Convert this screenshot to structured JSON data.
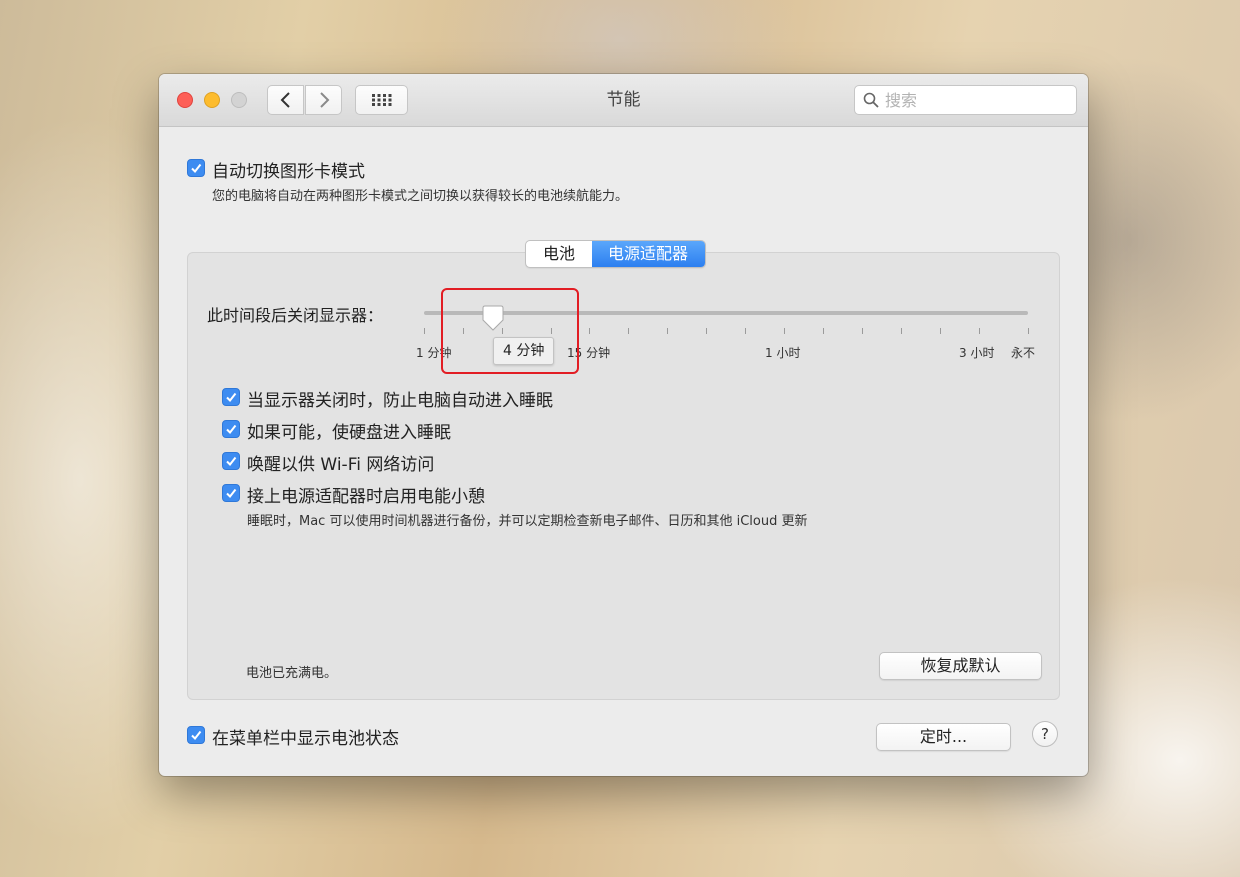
{
  "window": {
    "title": "节能",
    "search_placeholder": "搜索",
    "accent_color": "#3d8cf1"
  },
  "graphics_switching": {
    "checked": true,
    "label": "自动切换图形卡模式",
    "description": "您的电脑将自动在两种图形卡模式之间切换以获得较长的电池续航能力。"
  },
  "tabs": [
    {
      "label": "电池",
      "selected": false
    },
    {
      "label": "电源适配器",
      "selected": true
    }
  ],
  "display_sleep": {
    "label": "此时间段后关闭显示器：",
    "current_value": "4 分钟",
    "tick_labels": [
      "1 分钟",
      "15 分钟",
      "1 小时",
      "3 小时",
      "永不"
    ]
  },
  "options": [
    {
      "label": "当显示器关闭时，防止电脑自动进入睡眠",
      "checked": true
    },
    {
      "label": "如果可能，使硬盘进入睡眠",
      "checked": true
    },
    {
      "label": "唤醒以供 Wi-Fi 网络访问",
      "checked": true
    },
    {
      "label": "接上电源适配器时启用电能小憩",
      "checked": true,
      "description": "睡眠时，Mac 可以使用时间机器进行备份，并可以定期检查新电子邮件、日历和其他 iCloud 更新"
    }
  ],
  "battery_status": "电池已充满电。",
  "restore_defaults_label": "恢复成默认",
  "menubar_battery": {
    "label": "在菜单栏中显示电池状态",
    "checked": true
  },
  "schedule_label": "定时...",
  "help_label": "?"
}
